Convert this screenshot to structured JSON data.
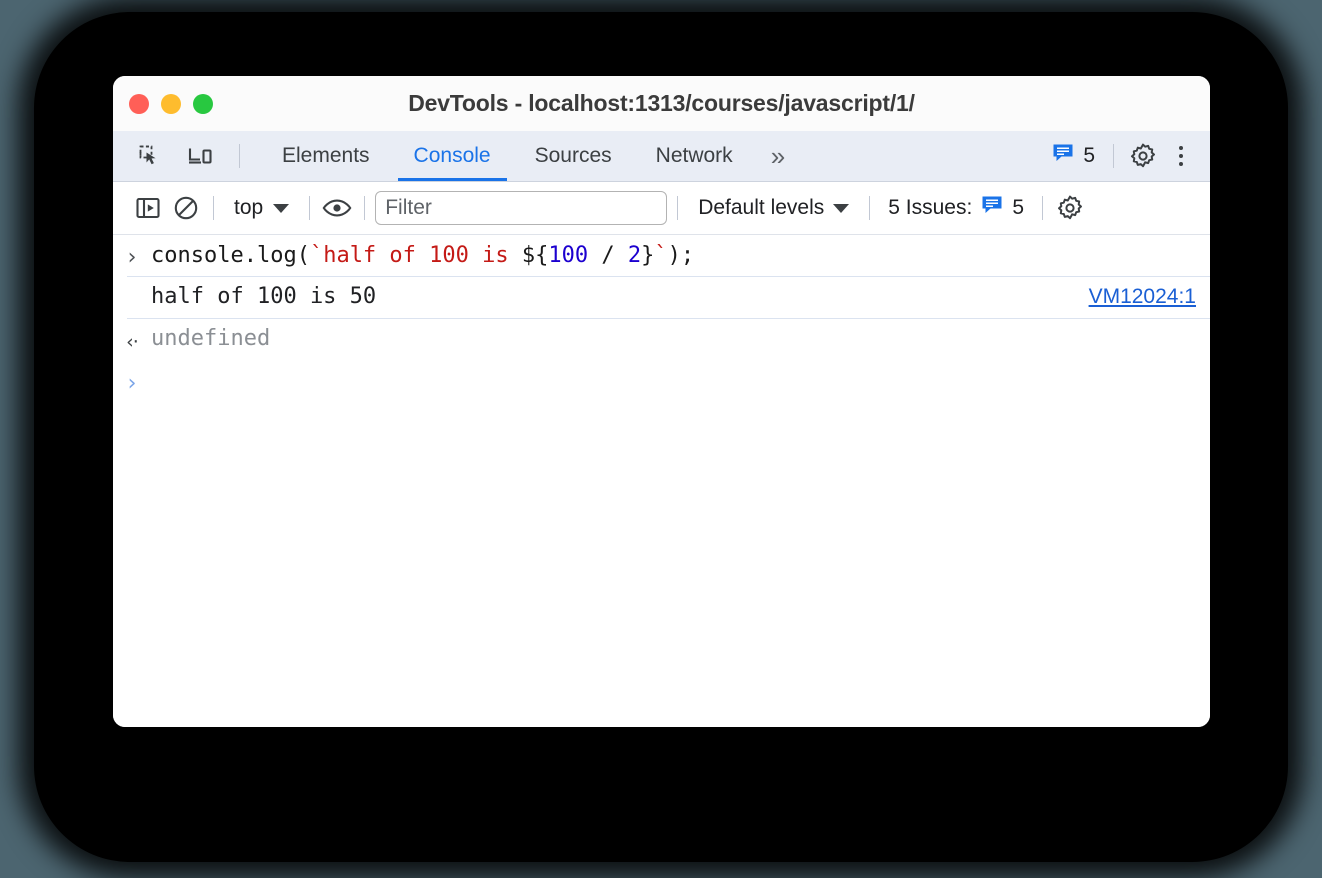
{
  "window": {
    "title": "DevTools - localhost:1313/courses/javascript/1/",
    "traffic_lights": [
      {
        "name": "close",
        "color": "#ff5f57"
      },
      {
        "name": "minimize",
        "color": "#febc2e"
      },
      {
        "name": "zoom",
        "color": "#28c840"
      }
    ]
  },
  "tabbar": {
    "inspect_icon": "inspect-element-icon",
    "device_icon": "device-toolbar-icon",
    "tabs": [
      {
        "label": "Elements",
        "active": false
      },
      {
        "label": "Console",
        "active": true
      },
      {
        "label": "Sources",
        "active": false
      },
      {
        "label": "Network",
        "active": false
      }
    ],
    "more_tabs_label": "»",
    "issues_count": "5",
    "issues_icon": "issues-message-icon",
    "settings_icon": "gear-icon",
    "menu_icon": "kebab-menu-icon",
    "accent_color": "#1a73e8"
  },
  "console_toolbar": {
    "sidebar_toggle_icon": "console-sidebar-toggle-icon",
    "clear_icon": "clear-console-icon",
    "context": "top",
    "eye_icon": "live-expression-eye-icon",
    "filter_placeholder": "Filter",
    "filter_value": "",
    "levels": "Default levels",
    "issues_label": "5 Issues:",
    "issues_count": "5",
    "settings_icon": "console-settings-gear-icon"
  },
  "console": {
    "input_row": {
      "prompt": "›",
      "tokens": [
        {
          "text": "console.log(",
          "type": "plain"
        },
        {
          "text": "`half of 100 is ",
          "type": "string"
        },
        {
          "text": "${",
          "type": "plain"
        },
        {
          "text": "100",
          "type": "number"
        },
        {
          "text": " / ",
          "type": "plain"
        },
        {
          "text": "2",
          "type": "number"
        },
        {
          "text": "}",
          "type": "plain"
        },
        {
          "text": "`",
          "type": "string"
        },
        {
          "text": ");",
          "type": "plain"
        }
      ]
    },
    "log_row": {
      "text": "half of 100 is 50",
      "source_link": "VM12024:1"
    },
    "result_row": {
      "prompt": "‹·",
      "text": "undefined"
    },
    "prompt_row": {
      "prompt": "›"
    }
  }
}
